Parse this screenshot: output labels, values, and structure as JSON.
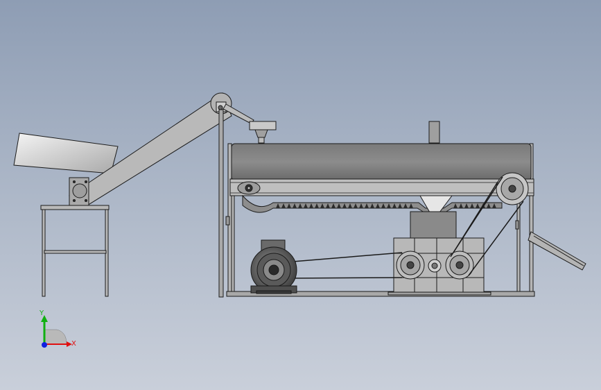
{
  "triad": {
    "x_label": "X",
    "y_label": "Y",
    "x_color": "#e01010",
    "y_color": "#10b010",
    "z_color": "#1020e0"
  },
  "colors": {
    "background_top": "#8e9db4",
    "background_bottom": "#c9cfda",
    "part_fill": "#bdbdbd",
    "part_dark": "#6f6f6f",
    "edge": "#1a1a1a"
  }
}
